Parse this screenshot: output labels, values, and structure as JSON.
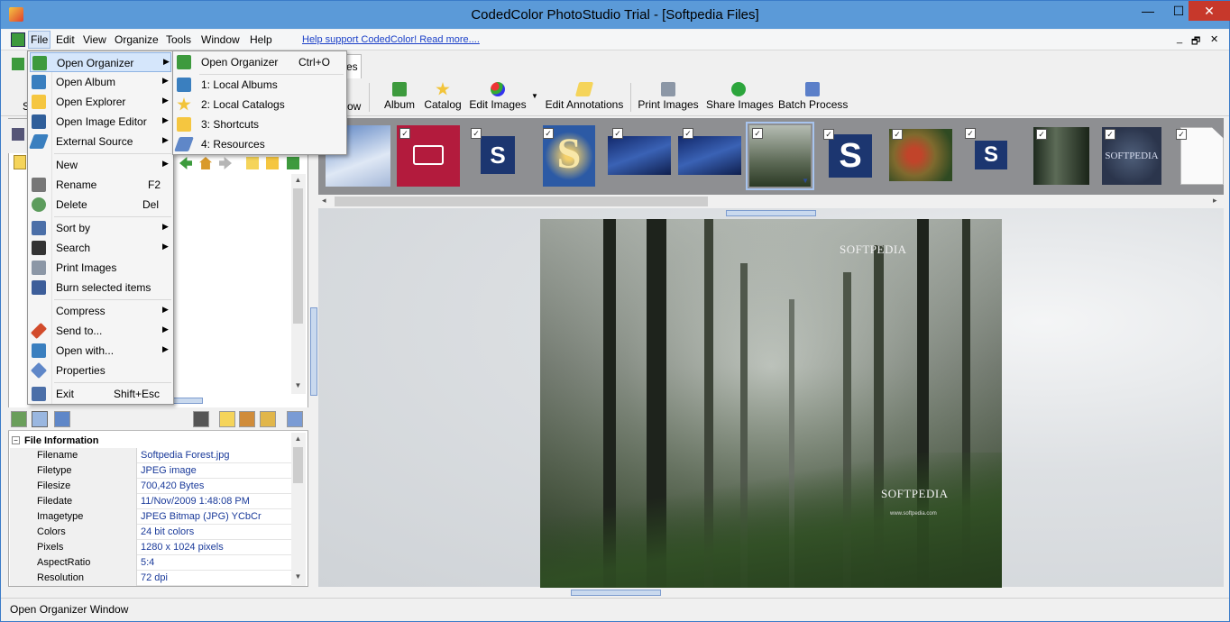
{
  "window": {
    "title": "CodedColor PhotoStudio Trial - [Softpedia Files]",
    "min_glyph": "—",
    "max_glyph": "☐",
    "close_glyph": "✕"
  },
  "menubar": {
    "items": [
      "File",
      "Edit",
      "View",
      "Organize",
      "Tools",
      "Window",
      "Help"
    ],
    "support_link": "Help support CodedColor! Read more....",
    "mdi_min": "_",
    "mdi_restore": "🗗",
    "mdi_close": "✕"
  },
  "tab_fragment": "es",
  "toolbar": {
    "partial_left": "S",
    "partial_view": "ow",
    "buttons": [
      {
        "label": "Album",
        "icon": "album-icon"
      },
      {
        "label": "Catalog",
        "icon": "star-icon"
      },
      {
        "label": "Edit Images",
        "icon": "palette-icon"
      },
      {
        "label": "Edit Annotations",
        "icon": "pen-icon"
      },
      {
        "label": "Print Images",
        "icon": "printer-icon"
      },
      {
        "label": "Share Images",
        "icon": "share-icon"
      },
      {
        "label": "Batch Process",
        "icon": "batch-icon"
      }
    ]
  },
  "file_menu": {
    "items": [
      {
        "label": "Open Organizer",
        "shortcut": "",
        "submenu": true
      },
      {
        "label": "Open Album",
        "shortcut": "",
        "submenu": true
      },
      {
        "label": "Open Explorer",
        "shortcut": "",
        "submenu": true
      },
      {
        "label": "Open Image Editor",
        "shortcut": "",
        "submenu": true
      },
      {
        "label": "External Source",
        "shortcut": "",
        "submenu": true
      },
      {
        "label": "New",
        "shortcut": "",
        "submenu": true
      },
      {
        "label": "Rename",
        "shortcut": "F2",
        "submenu": false
      },
      {
        "label": "Delete",
        "shortcut": "Del",
        "submenu": false
      },
      {
        "label": "Sort by",
        "shortcut": "",
        "submenu": true
      },
      {
        "label": "Search",
        "shortcut": "",
        "submenu": true
      },
      {
        "label": "Print Images",
        "shortcut": "",
        "submenu": false
      },
      {
        "label": "Burn selected items",
        "shortcut": "",
        "submenu": false
      },
      {
        "label": "Compress",
        "shortcut": "",
        "submenu": true
      },
      {
        "label": "Send to...",
        "shortcut": "",
        "submenu": true
      },
      {
        "label": "Open with...",
        "shortcut": "",
        "submenu": true
      },
      {
        "label": "Properties",
        "shortcut": "",
        "submenu": false
      },
      {
        "label": "Exit",
        "shortcut": "Shift+Esc",
        "submenu": false
      }
    ]
  },
  "submenu": {
    "items": [
      {
        "label": "Open Organizer",
        "shortcut": "Ctrl+O"
      },
      {
        "label": "1:  Local Albums",
        "shortcut": ""
      },
      {
        "label": "2:  Local Catalogs",
        "shortcut": ""
      },
      {
        "label": "3:  Shortcuts",
        "shortcut": ""
      },
      {
        "label": "4:  Resources",
        "shortcut": ""
      }
    ]
  },
  "file_info": {
    "header": "File Information",
    "collapse_glyph": "−",
    "rows": [
      {
        "key": "Filename",
        "value": "Softpedia Forest.jpg"
      },
      {
        "key": "Filetype",
        "value": "JPEG image"
      },
      {
        "key": "Filesize",
        "value": "700,420 Bytes"
      },
      {
        "key": "Filedate",
        "value": "11/Nov/2009 1:48:08 PM"
      },
      {
        "key": "Imagetype",
        "value": "JPEG Bitmap (JPG) YCbCr"
      },
      {
        "key": "Colors",
        "value": "24 bit colors"
      },
      {
        "key": "Pixels",
        "value": "1280 x 1024 pixels"
      },
      {
        "key": "AspectRatio",
        "value": "5:4"
      },
      {
        "key": "Resolution",
        "value": "72 dpi"
      }
    ]
  },
  "preview": {
    "watermark_top": "SOFTPEDIA",
    "watermark_bottom": "SOFTPEDIA",
    "watermark_url": "www.softpedia.com"
  },
  "thumbnails": {
    "checkmark": "✓",
    "s_letter": "S",
    "softpedia_text": "SOFTPEDIA"
  },
  "glyphs": {
    "arrow_up": "▲",
    "arrow_down": "▼",
    "arrow_left": "◂",
    "arrow_right": "▸",
    "submenu_arrow": "▶"
  },
  "statusbar": {
    "text": "Open Organizer Window"
  },
  "colors": {
    "titlebar": "#5b9ad8",
    "close_button": "#c7382b",
    "menu_highlight": "#d5e6fb",
    "link": "#1b40c8",
    "value_text": "#1a3a9a"
  }
}
